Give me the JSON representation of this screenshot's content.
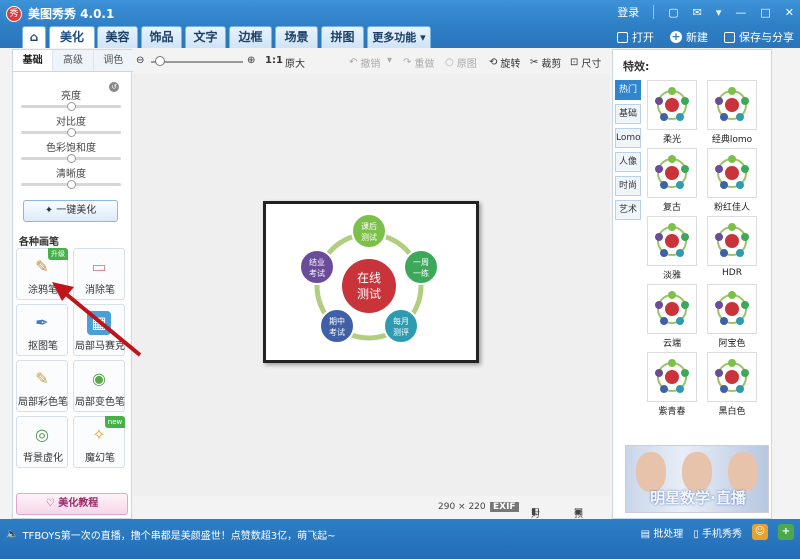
{
  "app": {
    "title": "美图秀秀 4.0.1",
    "logo_text": "秀"
  },
  "titlebar": {
    "login": "登录",
    "icons": [
      "chat-icon",
      "mail-icon",
      "dropdown-icon",
      "minimize-icon",
      "maximize-icon",
      "close-icon"
    ]
  },
  "menu": {
    "tabs": [
      {
        "label": "⌂",
        "name": "tab-home"
      },
      {
        "label": "美化",
        "name": "tab-beautify",
        "active": true
      },
      {
        "label": "美容",
        "name": "tab-beauty"
      },
      {
        "label": "饰品",
        "name": "tab-accessories"
      },
      {
        "label": "文字",
        "name": "tab-text"
      },
      {
        "label": "边框",
        "name": "tab-border"
      },
      {
        "label": "场景",
        "name": "tab-scene"
      },
      {
        "label": "拼图",
        "name": "tab-collage"
      },
      {
        "label": "更多功能 ▾",
        "name": "tab-more"
      }
    ],
    "open": "打开",
    "new": "新建",
    "save_share": "保存与分享"
  },
  "left": {
    "subtabs": [
      "基础",
      "高级",
      "调色"
    ],
    "sliders": [
      {
        "label": "亮度",
        "value": 0.5
      },
      {
        "label": "对比度",
        "value": 0.5
      },
      {
        "label": "色彩饱和度",
        "value": 0.5
      },
      {
        "label": "清晰度",
        "value": 0.5
      }
    ],
    "one_key": "一键美化",
    "section": "各种画笔",
    "brushes": [
      {
        "label": "涂鸦笔",
        "badge": "升级"
      },
      {
        "label": "消除笔"
      },
      {
        "label": "抠图笔"
      },
      {
        "label": "局部马赛克"
      },
      {
        "label": "局部彩色笔"
      },
      {
        "label": "局部变色笔"
      },
      {
        "label": "背景虚化"
      },
      {
        "label": "魔幻笔",
        "badge": "new"
      }
    ],
    "tutorial": "美化教程"
  },
  "toolbar": {
    "ratio": "1:1",
    "original_size": "原大",
    "undo": "撤销",
    "redo": "重做",
    "original": "原图",
    "rotate": "旋转",
    "crop": "裁剪",
    "size": "尺寸"
  },
  "canvas": {
    "center_lines": [
      "在线",
      "测试"
    ],
    "nodes": [
      {
        "lines": [
          "课后",
          "测试"
        ],
        "color": "#7cc04a"
      },
      {
        "lines": [
          "一周",
          "一练"
        ],
        "color": "#3ea85a"
      },
      {
        "lines": [
          "每月",
          "测评"
        ],
        "color": "#2f9bb0"
      },
      {
        "lines": [
          "期中",
          "考试"
        ],
        "color": "#3f5fa6"
      },
      {
        "lines": [
          "结业",
          "考试"
        ],
        "color": "#6b4c9b"
      }
    ],
    "center_color": "#c9343a"
  },
  "status": {
    "dims": "290 × 220",
    "exif": "EXIF",
    "compare": "对比",
    "preview": "预览"
  },
  "right": {
    "title": "特效:",
    "tabs": [
      "热门",
      "基础",
      "Lomo",
      "人像",
      "时尚",
      "艺术"
    ],
    "effects": [
      "柔光",
      "经典lomo",
      "复古",
      "粉红佳人",
      "淡雅",
      "HDR",
      "云端",
      "阿宝色",
      "紫青春",
      "黑白色"
    ],
    "banner_text": "明星数学·直播"
  },
  "bottom": {
    "ticker": "TFBOYS第一次の直播，撸个串都是美颜盛世！点赞数超3亿，萌飞起~",
    "batch": "批处理",
    "tiaozhuan": "手机秀秀"
  }
}
